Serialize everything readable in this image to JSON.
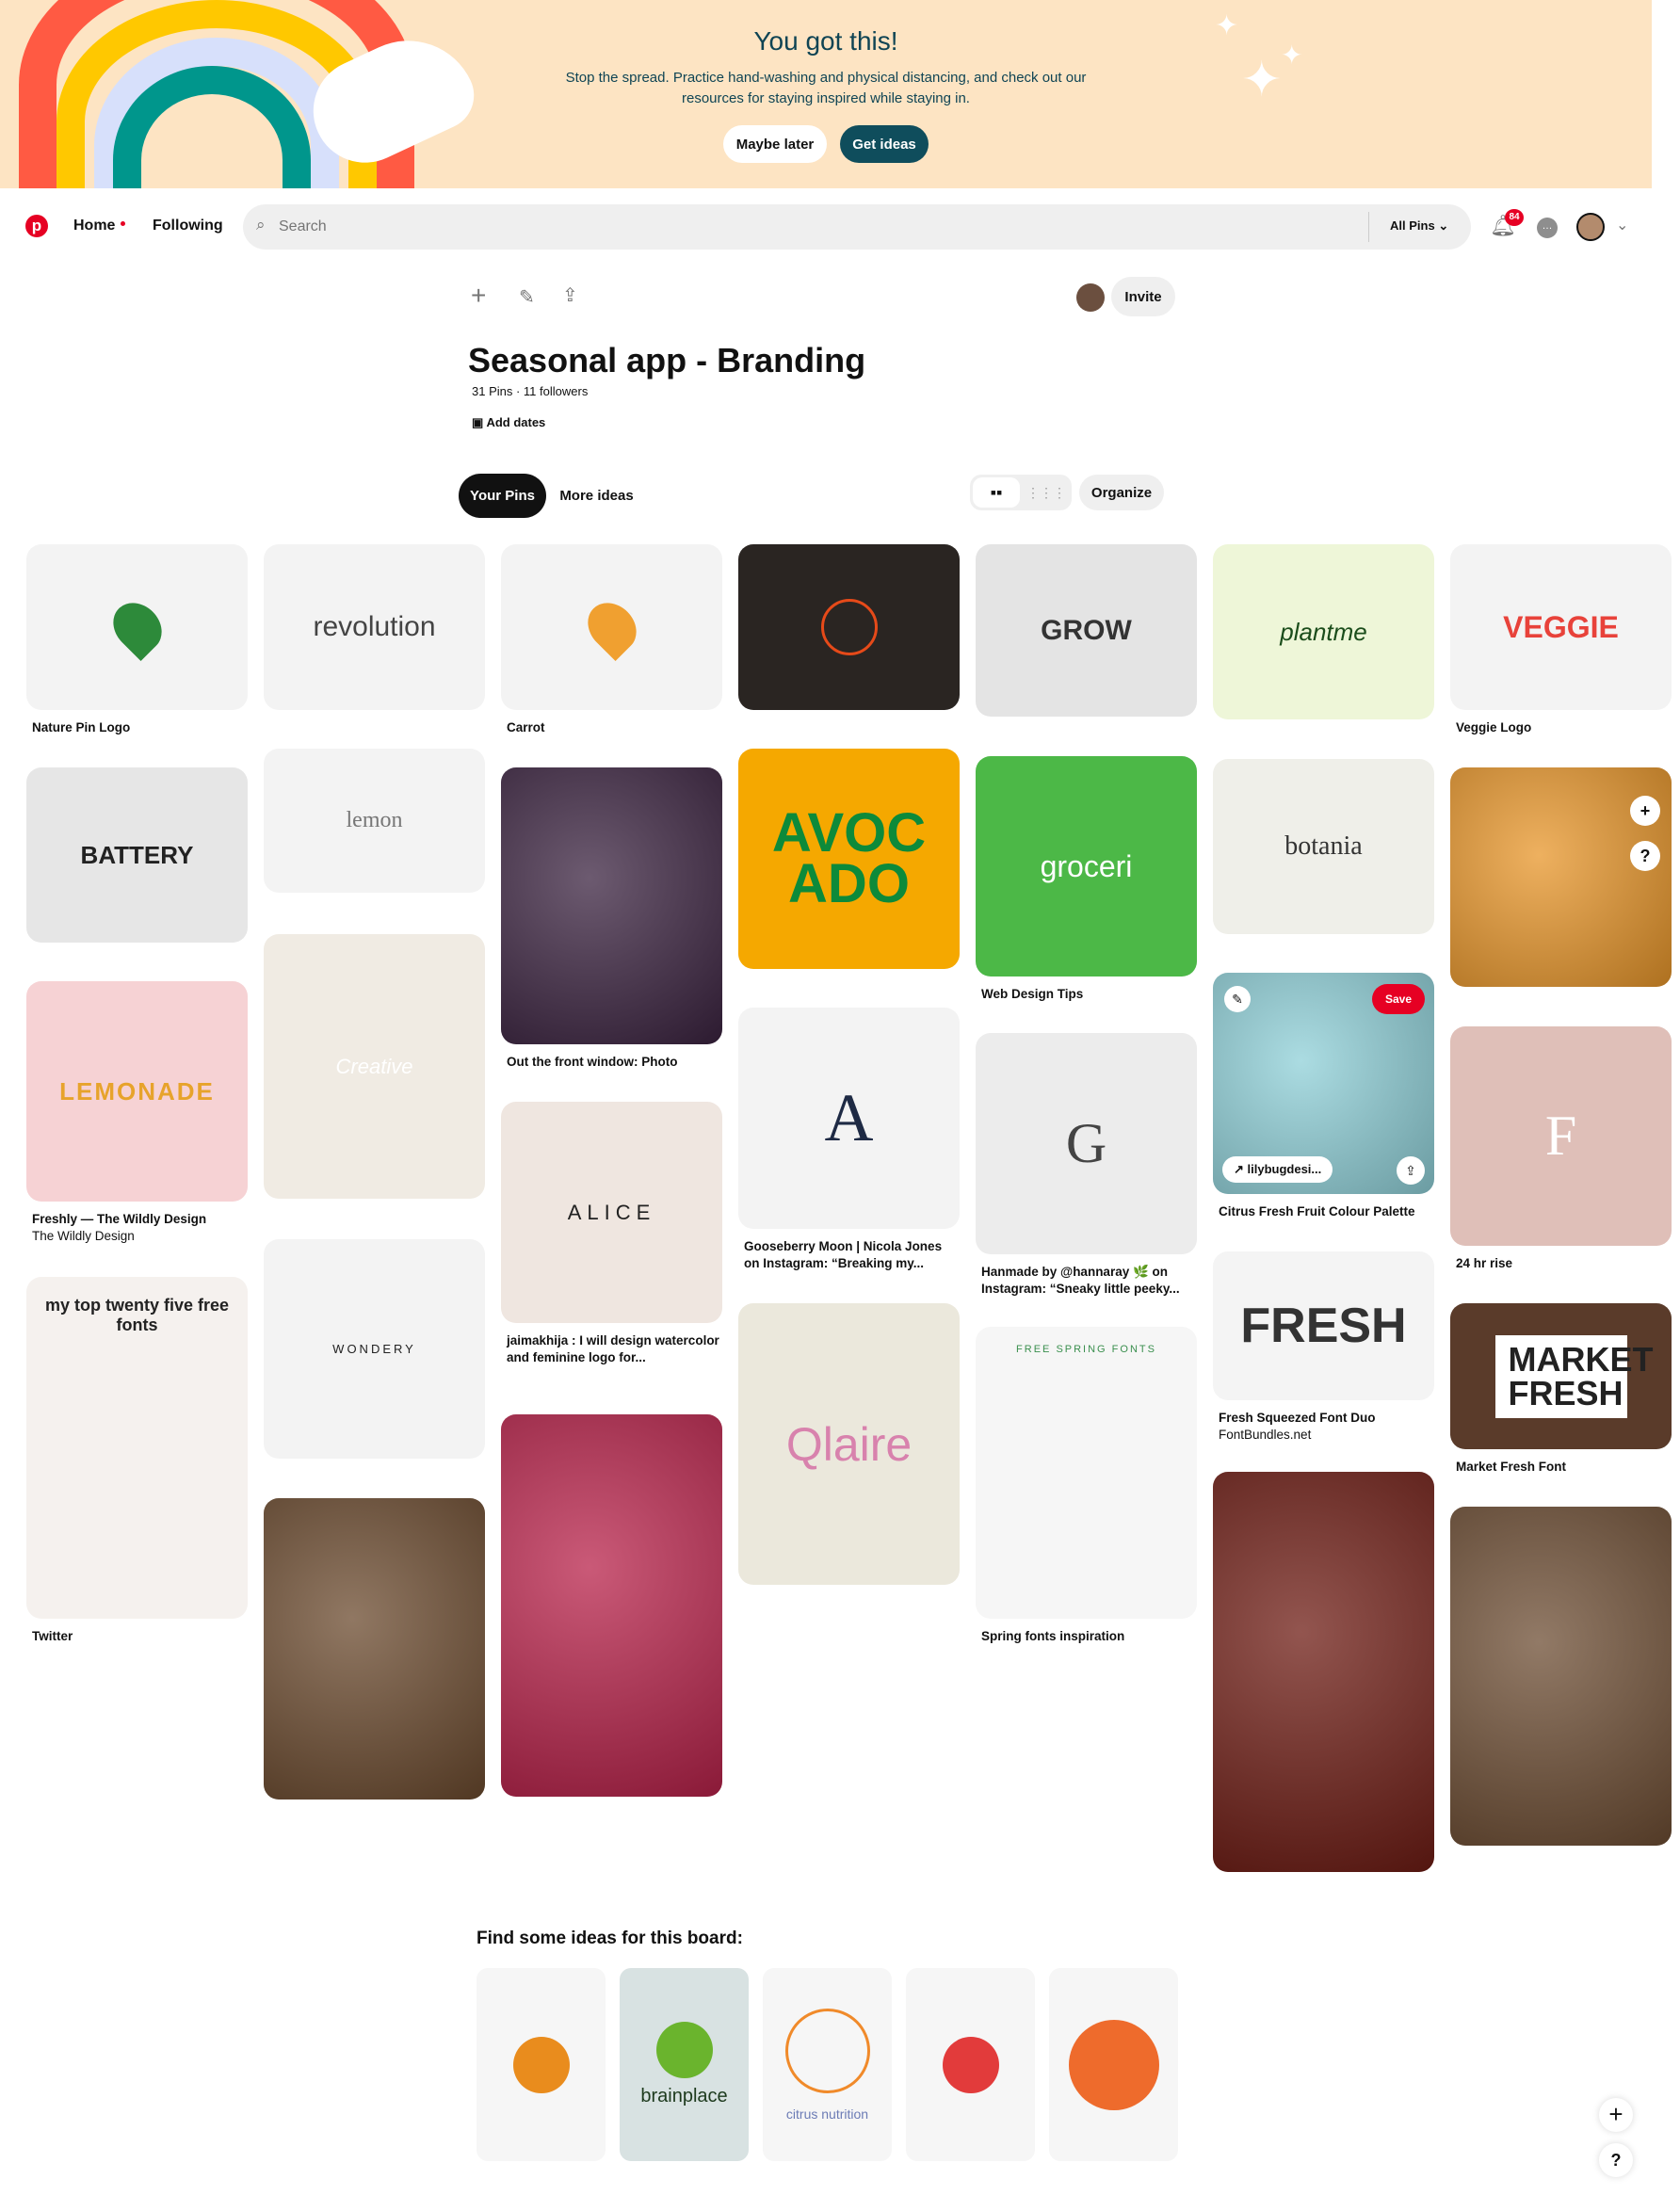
{
  "banner": {
    "title": "You got this!",
    "message": "Stop the spread. Practice hand-washing and physical distancing, and check out our resources for staying inspired while staying in.",
    "maybe_later": "Maybe later",
    "get_ideas": "Get ideas",
    "colors": {
      "bg": "#fde4c3",
      "button_dark": "#0f4d5c"
    }
  },
  "nav": {
    "home": "Home",
    "following": "Following",
    "search_placeholder": "Search",
    "scope": "All Pins",
    "notification_count": "84",
    "brand_color": "#e60023"
  },
  "board": {
    "title": "Seasonal app - Branding",
    "stats": "31 Pins · 11 followers",
    "add_dates": "Add dates",
    "invite": "Invite",
    "tabs": [
      {
        "label": "Your Pins",
        "active": true
      },
      {
        "label": "More ideas",
        "active": false
      }
    ],
    "organize": "Organize"
  },
  "pins": [
    {
      "image_text": "",
      "caption": "Nature Pin Logo",
      "bg": "#f3f3f3",
      "icon": "leaf-pin-icon"
    },
    {
      "image_text": "BATTERY",
      "caption": "",
      "bg": "#e6e6e6"
    },
    {
      "image_text": "LEMONADE",
      "caption": "Freshly — The Wildly Design",
      "sub": "The Wildly Design",
      "bg": "#f6d2d4"
    },
    {
      "image_text": "my top twenty five free fonts",
      "caption": "Twitter",
      "bg": "#f5f1ee"
    },
    {
      "image_text": "revolution",
      "caption": "",
      "bg": "#f3f3f3"
    },
    {
      "image_text": "lemon",
      "caption": "",
      "bg": "#f3f3f3"
    },
    {
      "image_text": "Creative",
      "caption": "",
      "bg": "#f0ebe3"
    },
    {
      "image_text": "WONDERY",
      "caption": "",
      "bg": "#f3f3f3"
    },
    {
      "image_text": "",
      "caption": "",
      "bg": "#6b4a2e"
    },
    {
      "image_text": "",
      "caption": "Carrot",
      "bg": "#f3f3f3",
      "icon": "carrot-pin-icon"
    },
    {
      "image_text": "",
      "caption": "Out the front window: Photo",
      "bg": "#3b2340"
    },
    {
      "image_text": "ALICE",
      "caption": "jaimakhija : I will design watercolor and feminine logo for...",
      "bg": "#efe6e0"
    },
    {
      "image_text": "",
      "caption": "",
      "bg": "#b8224a"
    },
    {
      "image_text": "",
      "caption": "",
      "bg": "#2a2522",
      "icon": "orange-outline-icon"
    },
    {
      "image_text": "AVOCADO",
      "caption": "",
      "bg": "#f5a800"
    },
    {
      "image_text": "A",
      "caption": "Gooseberry Moon | Nicola Jones on Instagram: “Breaking my...",
      "bg": "#f3f3f3"
    },
    {
      "image_text": "Qlaire",
      "caption": "",
      "bg": "#ebe8dc"
    },
    {
      "image_text": "GROW",
      "caption": "",
      "bg": "#e4e4e4"
    },
    {
      "image_text": "groceri",
      "caption": "Web Design Tips",
      "bg": "#4cb847"
    },
    {
      "image_text": "G",
      "caption": "Hanmade by @hannaray 🌿 on Instagram: “Sneaky little peeky...",
      "bg": "#ececec"
    },
    {
      "image_text": "FREE SPRING FONTS",
      "caption": "Spring fonts inspiration",
      "bg": "#f6f6f6"
    },
    {
      "image_text": "plantme",
      "caption": "",
      "bg": "#eef6d8"
    },
    {
      "image_text": "botania",
      "caption": "",
      "bg": "#efefe9"
    },
    {
      "image_text": "",
      "caption": "Citrus Fresh Fruit Colour Palette",
      "bg": "#8fd0d8",
      "save": "Save",
      "source": "lilybugdesi..."
    },
    {
      "image_text": "FRESH",
      "caption": "Fresh Squeezed Font Duo",
      "sub": "FontBundles.net",
      "bg": "#f4f4f4"
    },
    {
      "image_text": "",
      "caption": "",
      "bg": "#6e1c14"
    },
    {
      "image_text": "VEGGIE",
      "caption": "Veggie Logo",
      "bg": "#f3f3f3"
    },
    {
      "image_text": "",
      "caption": "",
      "bg": "#e8962a"
    },
    {
      "image_text": "F",
      "caption": "24 hr rise",
      "bg": "#dfbfb8"
    },
    {
      "image_text": "MARKET FRESH",
      "caption": "Market Fresh Font",
      "bg": "#5a3b2a"
    },
    {
      "image_text": "",
      "caption": "",
      "bg": "#6d4d33"
    }
  ],
  "ideas": {
    "title": "Find some ideas for this board:",
    "items": [
      {
        "text": "",
        "bg": "#f6f6f6",
        "icon": "orange-icon"
      },
      {
        "text": "brainplace",
        "bg": "#d8e2e2",
        "icon": "brain-leaf-icon"
      },
      {
        "text": "citrus nutrition",
        "bg": "#f6f6f6",
        "icon": "orange-outline-icon"
      },
      {
        "text": "",
        "bg": "#f6f6f6",
        "icon": "watermelon-wifi-icon"
      },
      {
        "text": "",
        "bg": "#f6f6f6",
        "icon": "orange-tag-icon"
      }
    ]
  }
}
